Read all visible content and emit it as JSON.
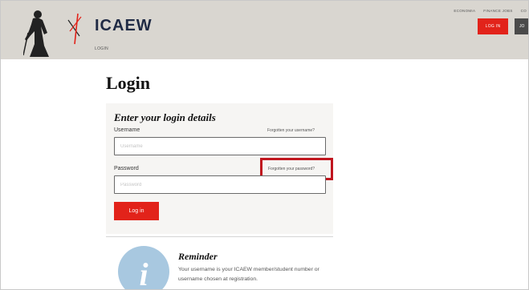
{
  "header": {
    "brand": "ICAEW",
    "breadcrumb": "LOGIN",
    "top_links": [
      "ECONOMIA",
      "FINANCE JOBS",
      "CO"
    ],
    "login_button": "LOG IN",
    "join_button": "JO",
    "accent_color": "#e2231a"
  },
  "page": {
    "title": "Login"
  },
  "form": {
    "heading": "Enter your login details",
    "username_label": "Username",
    "username_placeholder": "Username",
    "forgot_username": "Forgotten your username?",
    "password_label": "Password",
    "password_placeholder": "Password",
    "forgot_password": "Forgotten your password?",
    "submit_label": "Log in"
  },
  "reminder": {
    "icon": "info-icon",
    "icon_glyph": "i",
    "title": "Reminder",
    "text": "Your username is your ICAEW member/student number or username chosen at registration."
  }
}
